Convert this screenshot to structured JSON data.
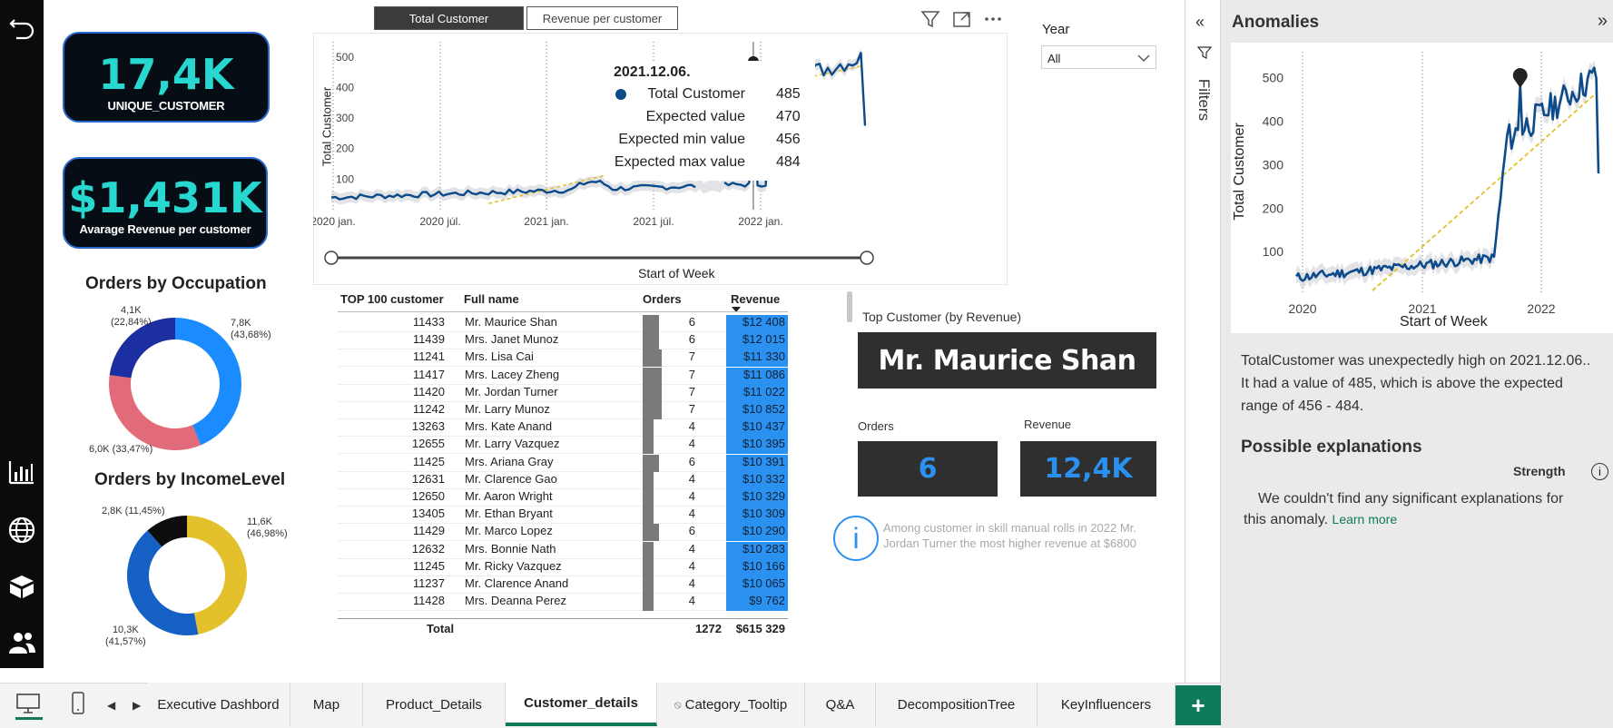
{
  "kpis": {
    "unique_customer_value": "17,4K",
    "unique_customer_label": "UNIQUE_CUSTOMER",
    "avg_revenue_value": "$1,431K",
    "avg_revenue_label": "Avarage Revenue per customer"
  },
  "occupation": {
    "title": "Orders by Occupation",
    "labels": [
      "4,1K",
      "(22,84%)",
      "7,8K",
      "(43,68%)",
      "6,0K (33,47%)"
    ],
    "slices": [
      {
        "value": 43.68,
        "color": "#1a8cff"
      },
      {
        "value": 33.47,
        "color": "#e26b7a"
      },
      {
        "value": 22.84,
        "color": "#1c2fa0"
      }
    ]
  },
  "income": {
    "title": "Orders by IncomeLevel",
    "labels": [
      "2,8K (11,45%)",
      "11,6K",
      "(46,98%)",
      "10,3K",
      "(41,57%)"
    ],
    "slices": [
      {
        "value": 46.98,
        "color": "#e3c12c"
      },
      {
        "value": 41.57,
        "color": "#1460c4"
      },
      {
        "value": 11.45,
        "color": "#0d0d0d"
      }
    ]
  },
  "top_tabs": [
    "Total Customer",
    "Revenue per customer"
  ],
  "year_filter": {
    "label": "Year",
    "value": "All"
  },
  "main_chart": {
    "y_label": "Total Customer",
    "x_label": "Start of Week",
    "y_ticks": [
      "500",
      "400",
      "300",
      "200",
      "100"
    ],
    "x_ticks": [
      "2020 jan.",
      "2020 júl.",
      "2021 jan.",
      "2021 júl.",
      "2022 jan."
    ]
  },
  "tooltip": {
    "date": "2021.12.06.",
    "rows": [
      {
        "label": "Total Customer",
        "value": "485"
      },
      {
        "label": "Expected value",
        "value": "470"
      },
      {
        "label": "Expected min value",
        "value": "456"
      },
      {
        "label": "Expected max value",
        "value": "484"
      }
    ]
  },
  "table": {
    "headers": [
      "TOP 100 customer",
      "Full name",
      "Orders",
      "Revenue"
    ],
    "rows": [
      {
        "id": "11433",
        "name": "Mr. Maurice Shan",
        "orders": 6,
        "rev": "$12 408"
      },
      {
        "id": "11439",
        "name": "Mrs. Janet Munoz",
        "orders": 6,
        "rev": "$12 015"
      },
      {
        "id": "11241",
        "name": "Mrs. Lisa Cai",
        "orders": 7,
        "rev": "$11 330"
      },
      {
        "id": "11417",
        "name": "Mrs. Lacey Zheng",
        "orders": 7,
        "rev": "$11 086"
      },
      {
        "id": "11420",
        "name": "Mr. Jordan Turner",
        "orders": 7,
        "rev": "$11 022"
      },
      {
        "id": "11242",
        "name": "Mr. Larry Munoz",
        "orders": 7,
        "rev": "$10 852"
      },
      {
        "id": "13263",
        "name": "Mrs. Kate Anand",
        "orders": 4,
        "rev": "$10 437"
      },
      {
        "id": "12655",
        "name": "Mr. Larry Vazquez",
        "orders": 4,
        "rev": "$10 395"
      },
      {
        "id": "11425",
        "name": "Mrs. Ariana Gray",
        "orders": 6,
        "rev": "$10 391"
      },
      {
        "id": "12631",
        "name": "Mr. Clarence Gao",
        "orders": 4,
        "rev": "$10 332"
      },
      {
        "id": "12650",
        "name": "Mr. Aaron Wright",
        "orders": 4,
        "rev": "$10 329"
      },
      {
        "id": "13405",
        "name": "Mr. Ethan Bryant",
        "orders": 4,
        "rev": "$10 309"
      },
      {
        "id": "11429",
        "name": "Mr. Marco Lopez",
        "orders": 6,
        "rev": "$10 290"
      },
      {
        "id": "12632",
        "name": "Mrs. Bonnie Nath",
        "orders": 4,
        "rev": "$10 283"
      },
      {
        "id": "11245",
        "name": "Mr. Ricky Vazquez",
        "orders": 4,
        "rev": "$10 166"
      },
      {
        "id": "11237",
        "name": "Mr. Clarence Anand",
        "orders": 4,
        "rev": "$10 065"
      },
      {
        "id": "11428",
        "name": "Mrs. Deanna Perez",
        "orders": 4,
        "rev": "$9 762"
      }
    ],
    "total_label": "Total",
    "total_orders": "1272",
    "total_revenue": "$615 329"
  },
  "top_customer": {
    "label": "Top Customer (by Revenue)",
    "name": "Mr. Maurice Shan",
    "orders_label": "Orders",
    "orders_value": "6",
    "revenue_label": "Revenue",
    "revenue_value": "12,4K"
  },
  "info_note": "Among customer in skill manual rolls in 2022 Mr. Jordan Turner the most higher revenue at $6800",
  "filters_label": "Filters",
  "anomalies": {
    "title": "Anomalies",
    "y_label": "Total Customer",
    "x_label": "Start of Week",
    "y_ticks": [
      "500",
      "400",
      "300",
      "200",
      "100"
    ],
    "x_ticks": [
      "2020",
      "2021",
      "2022"
    ],
    "description": "TotalCustomer was unexpectedly high on 2021.12.06.. It had a value of 485, which is above the expected range of 456 - 484.",
    "explanations_title": "Possible explanations",
    "strength_label": "Strength",
    "no_explanations": "We couldn't find any significant explanations for this anomaly.",
    "learn_more": "Learn more"
  },
  "bottom_tabs": [
    "Executive Dashbord",
    "Map",
    "Product_Details",
    "Customer_details",
    "Category_Tooltip",
    "Q&A",
    "DecompositionTree",
    "KeyInfluencers"
  ],
  "active_bottom_tab": "Customer_details",
  "colors": {
    "accent_teal": "#27d7d0",
    "line_blue": "#0d4a8a",
    "expected_gold": "#e3c12c",
    "revenue_blue": "#2b91f1",
    "active_tab_green": "#0e7a5a"
  }
}
